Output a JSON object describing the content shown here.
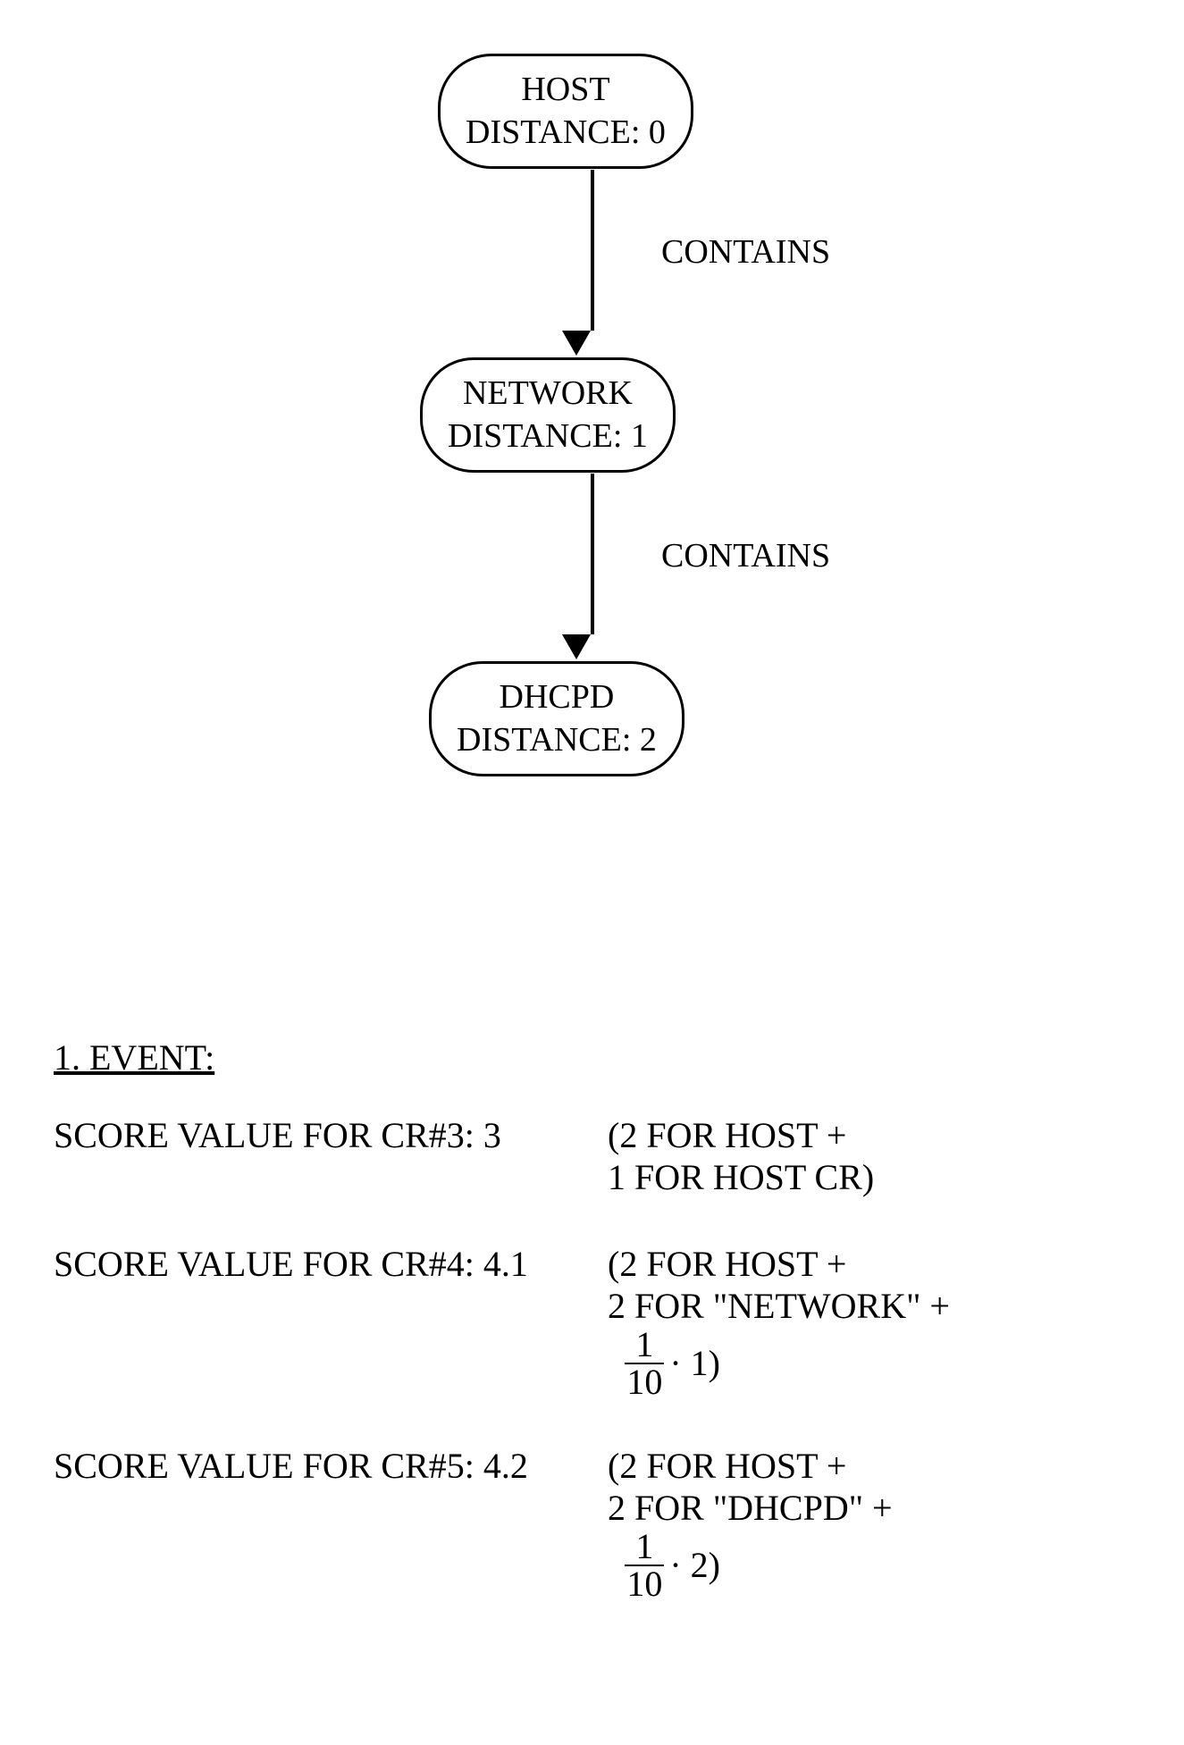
{
  "diagram": {
    "nodes": [
      {
        "line1": "HOST",
        "line2": "DISTANCE: 0"
      },
      {
        "line1": "NETWORK",
        "line2": "DISTANCE: 1"
      },
      {
        "line1": "DHCPD",
        "line2": "DISTANCE: 2"
      }
    ],
    "edge_label": "CONTAINS"
  },
  "event": {
    "heading": "1. EVENT:",
    "scores": [
      {
        "label": "SCORE VALUE FOR CR#3: 3",
        "explanation_lines": [
          "(2 FOR HOST +",
          " 1 FOR HOST CR)"
        ]
      },
      {
        "label": "SCORE VALUE FOR CR#4: 4.1",
        "explanation_lines": [
          "(2 FOR HOST +",
          " 2 FOR \"NETWORK\" +"
        ],
        "fraction": {
          "num": "1",
          "den": "10",
          "tail": " · 1)"
        }
      },
      {
        "label": "SCORE VALUE FOR CR#5: 4.2",
        "explanation_lines": [
          "(2 FOR HOST +",
          " 2 FOR \"DHCPD\" +"
        ],
        "fraction": {
          "num": "1",
          "den": "10",
          "tail": " · 2)"
        }
      }
    ]
  }
}
